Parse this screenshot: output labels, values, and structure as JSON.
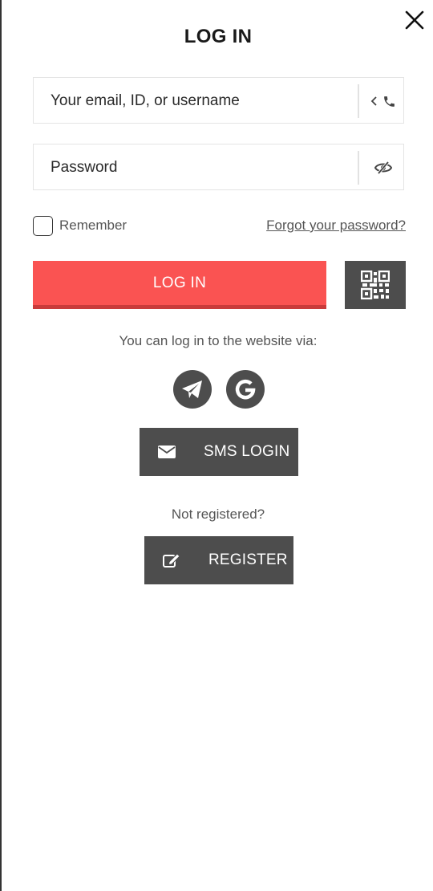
{
  "modal": {
    "title": "LOG IN",
    "close_icon": "close-icon"
  },
  "form": {
    "login_field": {
      "value": "Your email, ID, or username",
      "suffix_icons": [
        "chevron-left-icon",
        "phone-icon"
      ]
    },
    "password_field": {
      "value": "Password",
      "suffix_icon": "eye-slash-icon"
    },
    "remember_label": "Remember",
    "remember_checked": false,
    "forgot_link": "Forgot your password?",
    "login_button": "LOG IN",
    "qr_icon": "qr-code-icon"
  },
  "social": {
    "via_text": "You can log in to the website via:",
    "providers": [
      {
        "name": "telegram-icon"
      },
      {
        "name": "google-icon"
      }
    ],
    "sms_button": {
      "label": "SMS LOGIN",
      "icon": "envelope-icon"
    }
  },
  "register": {
    "prompt": "Not registered?",
    "button": {
      "label": "REGISTER",
      "icon": "edit-icon"
    }
  },
  "colors": {
    "primary_red": "#fa5352",
    "primary_red_shadow": "#c93b3b",
    "dark_button": "#4d4d4d",
    "text_muted": "#555555"
  }
}
